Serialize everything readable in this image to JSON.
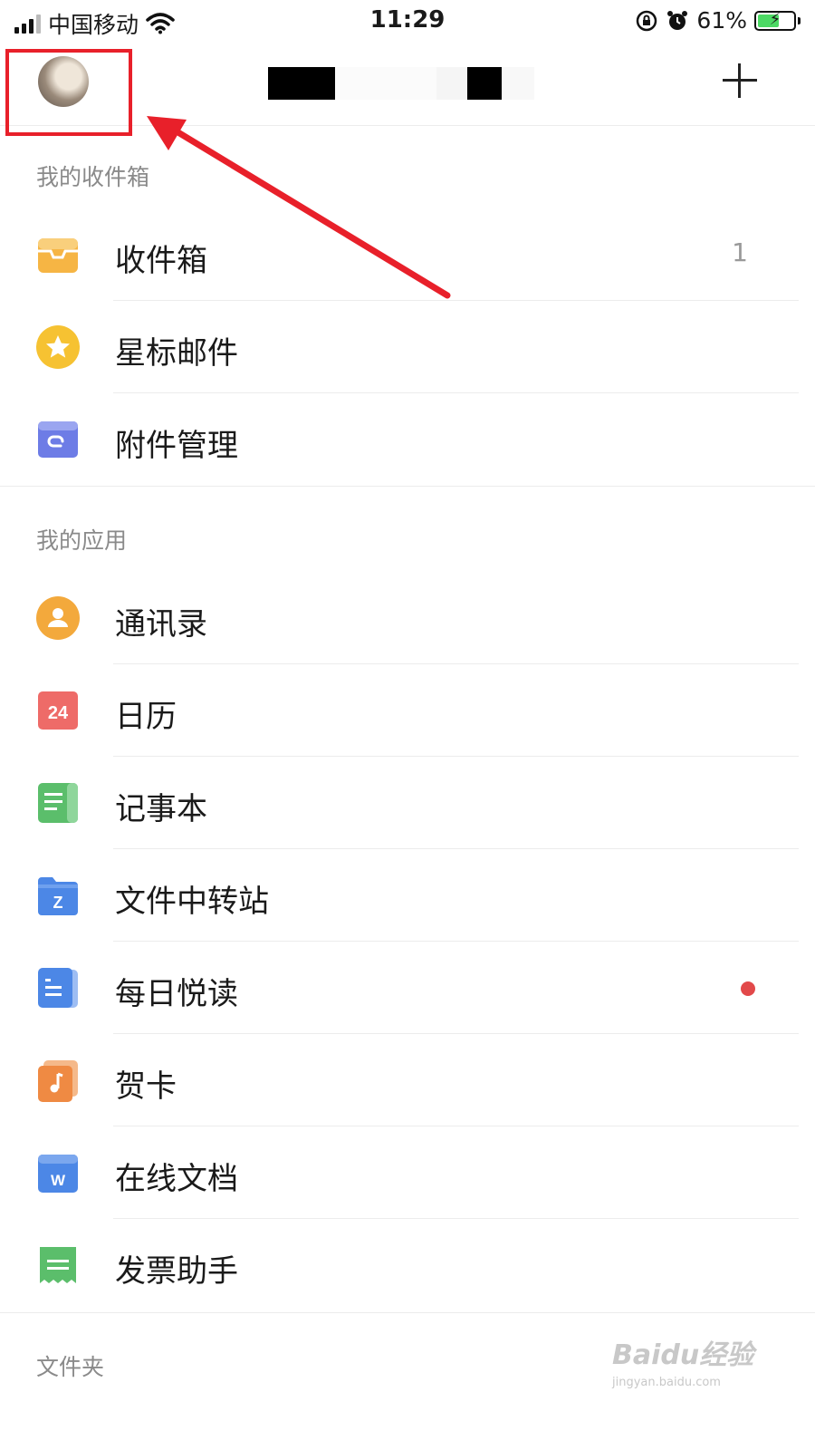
{
  "status_bar": {
    "carrier": "中国移动",
    "time": "11:29",
    "battery": "61%",
    "battery_level": 0.61
  },
  "header": {
    "avatar_icon": "avatar-photo",
    "add_icon": "plus-icon"
  },
  "sections": {
    "inbox": {
      "title": "我的收件箱",
      "items": [
        {
          "label": "收件箱",
          "icon": "inbox-tray-icon",
          "count": "1"
        },
        {
          "label": "星标邮件",
          "icon": "star-icon"
        },
        {
          "label": "附件管理",
          "icon": "attachment-folder-icon"
        }
      ]
    },
    "apps": {
      "title": "我的应用",
      "items": [
        {
          "label": "通讯录",
          "icon": "contacts-icon"
        },
        {
          "label": "日历",
          "icon": "calendar-icon",
          "icon_text": "24"
        },
        {
          "label": "记事本",
          "icon": "notebook-icon"
        },
        {
          "label": "文件中转站",
          "icon": "file-transfer-icon",
          "icon_text": "Z"
        },
        {
          "label": "每日悦读",
          "icon": "daily-reading-icon",
          "badge": "unread-dot"
        },
        {
          "label": "贺卡",
          "icon": "greeting-card-icon"
        },
        {
          "label": "在线文档",
          "icon": "online-doc-icon",
          "icon_text": "W"
        },
        {
          "label": "发票助手",
          "icon": "invoice-icon"
        }
      ]
    },
    "folders": {
      "title": "文件夹"
    }
  },
  "watermark": {
    "main": "Baidu经验",
    "sub": "jingyan.baidu.com"
  },
  "colors": {
    "annotation_red": "#e8202a",
    "inbox_yellow": "#f6b544",
    "star_yellow": "#f6c232",
    "attachment_purple": "#6d7ce6",
    "contacts_orange": "#f3a93c",
    "calendar_red": "#ee6b68",
    "notebook_green": "#5bbe6b",
    "file_blue": "#4c87e6",
    "card_orange": "#ef8a43",
    "unread_red": "#e2494a"
  }
}
